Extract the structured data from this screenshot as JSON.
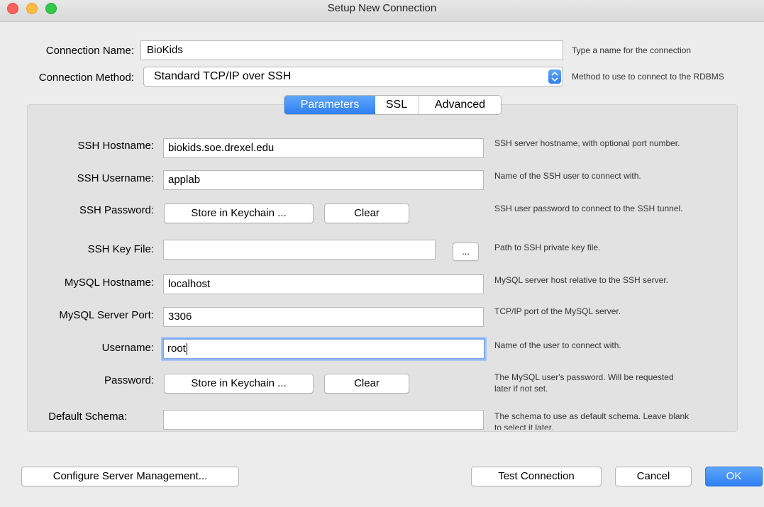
{
  "window": {
    "title": "Setup New Connection"
  },
  "top": {
    "connection_name_label": "Connection Name:",
    "connection_name_value": "BioKids",
    "connection_name_hint": "Type a name for the connection",
    "connection_method_label": "Connection Method:",
    "connection_method_value": "Standard TCP/IP over SSH",
    "connection_method_hint": "Method to use to connect to the RDBMS"
  },
  "tabs": [
    {
      "label": "Parameters",
      "active": true
    },
    {
      "label": "SSL",
      "active": false
    },
    {
      "label": "Advanced",
      "active": false
    }
  ],
  "params": {
    "ssh_hostname_label": "SSH Hostname:",
    "ssh_hostname_value": "biokids.soe.drexel.edu",
    "ssh_hostname_hint": "SSH server hostname, with  optional port number.",
    "ssh_username_label": "SSH Username:",
    "ssh_username_value": "applab",
    "ssh_username_hint": "Name of the SSH user to connect with.",
    "ssh_password_label": "SSH Password:",
    "ssh_password_store": "Store in Keychain ...",
    "ssh_password_clear": "Clear",
    "ssh_password_hint": "SSH user password to connect to the SSH tunnel.",
    "ssh_keyfile_label": "SSH Key File:",
    "ssh_keyfile_value": "",
    "ssh_keyfile_browse": "...",
    "ssh_keyfile_hint": "Path to SSH private key file.",
    "mysql_hostname_label": "MySQL Hostname:",
    "mysql_hostname_value": "localhost",
    "mysql_hostname_hint": "MySQL server host relative to the SSH server.",
    "mysql_port_label": "MySQL Server Port:",
    "mysql_port_value": "3306",
    "mysql_port_hint": "TCP/IP port of the MySQL server.",
    "username_label": "Username:",
    "username_value": "root",
    "username_hint": "Name of the user to connect with.",
    "password_label": "Password:",
    "password_store": "Store in Keychain ...",
    "password_clear": "Clear",
    "password_hint_line1": "The MySQL user's password. Will be requested",
    "password_hint_line2": "later if not set.",
    "schema_label": "Default Schema:",
    "schema_value": "",
    "schema_hint_line1": "The schema to use as default schema. Leave blank",
    "schema_hint_line2": "to select it later."
  },
  "footer": {
    "configure": "Configure Server Management...",
    "test": "Test Connection",
    "cancel": "Cancel",
    "ok": "OK"
  },
  "colors": {
    "accent": "#2f7ff4",
    "background": "#ececec",
    "panel": "#e2e2e2"
  }
}
